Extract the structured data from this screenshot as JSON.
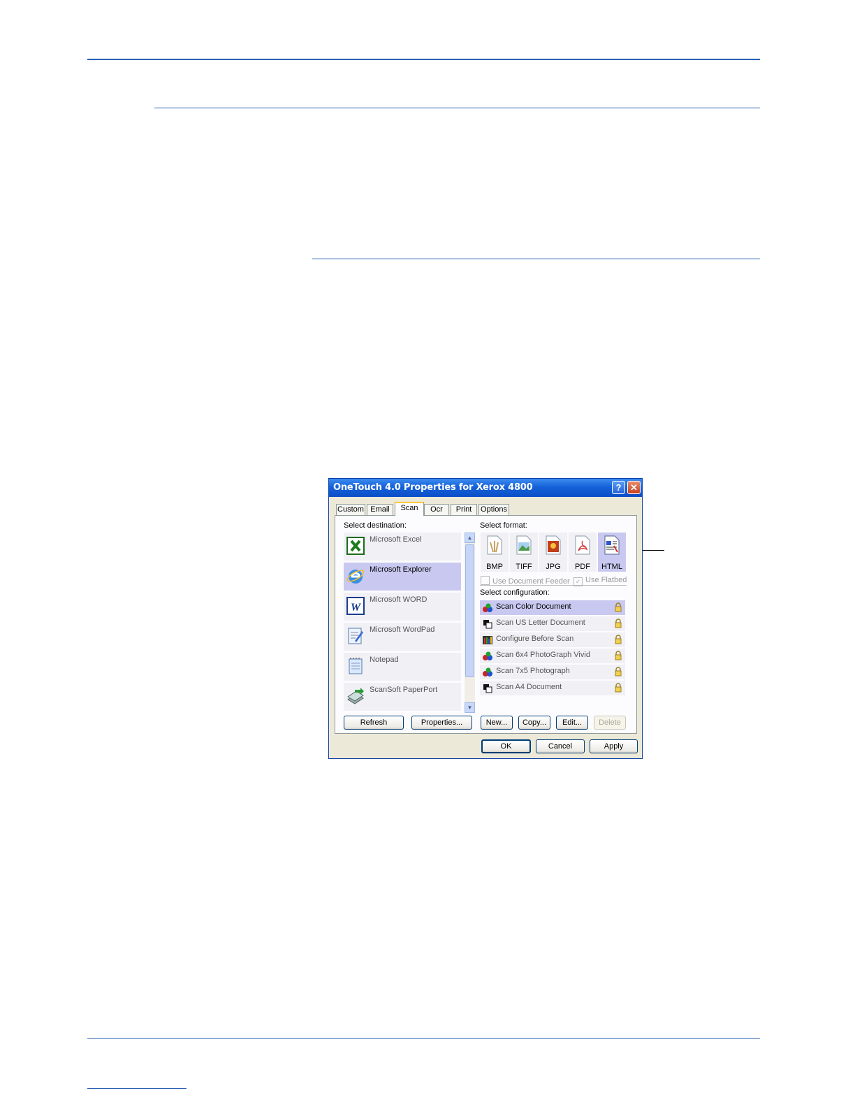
{
  "dialog": {
    "title": "OneTouch 4.0 Properties for Xerox 4800",
    "help_glyph": "?",
    "close_glyph": "✕",
    "tabs": [
      {
        "label": "Custom"
      },
      {
        "label": "Email"
      },
      {
        "label": "Scan"
      },
      {
        "label": "Ocr"
      },
      {
        "label": "Print"
      },
      {
        "label": "Options"
      }
    ],
    "active_tab": "Scan",
    "destination": {
      "label": "Select destination:",
      "items": [
        {
          "label": "Microsoft Excel",
          "icon": "excel-icon"
        },
        {
          "label": "Microsoft Explorer",
          "icon": "internet-explorer-icon",
          "selected": true
        },
        {
          "label": "Microsoft WORD",
          "icon": "word-icon"
        },
        {
          "label": "Microsoft WordPad",
          "icon": "wordpad-icon"
        },
        {
          "label": "Notepad",
          "icon": "notepad-icon"
        },
        {
          "label": "ScanSoft PaperPort",
          "icon": "paperport-icon"
        }
      ],
      "refresh_label": "Refresh",
      "properties_label": "Properties..."
    },
    "format": {
      "label": "Select format:",
      "items": [
        {
          "label": "BMP",
          "icon": "bmp-icon"
        },
        {
          "label": "TIFF",
          "icon": "tiff-icon"
        },
        {
          "label": "JPG",
          "icon": "jpg-icon"
        },
        {
          "label": "PDF",
          "icon": "pdf-icon"
        },
        {
          "label": "HTML",
          "icon": "html-icon",
          "selected": true
        }
      ],
      "use_document_feeder": "Use Document Feeder",
      "use_flatbed": "Use Flatbed",
      "use_flatbed_checked": true
    },
    "configuration": {
      "label": "Select configuration:",
      "items": [
        {
          "label": "Scan Color Document",
          "icon": "color-scan-icon",
          "selected": true
        },
        {
          "label": "Scan US Letter Document",
          "icon": "bw-scan-icon"
        },
        {
          "label": "Configure Before Scan",
          "icon": "configure-icon"
        },
        {
          "label": "Scan 6x4 PhotoGraph Vivid",
          "icon": "color-scan-icon"
        },
        {
          "label": "Scan 7x5 Photograph",
          "icon": "color-scan-icon"
        },
        {
          "label": "Scan A4 Document",
          "icon": "bw-scan-icon"
        }
      ],
      "new_label": "New...",
      "copy_label": "Copy...",
      "edit_label": "Edit...",
      "delete_label": "Delete"
    },
    "ok_label": "OK",
    "cancel_label": "Cancel",
    "apply_label": "Apply"
  },
  "colors": {
    "rule": "#2a5fb3",
    "titlebar": "#0a4ec7",
    "selection": "#c8c8f0",
    "dialog_face": "#ece9d8"
  }
}
